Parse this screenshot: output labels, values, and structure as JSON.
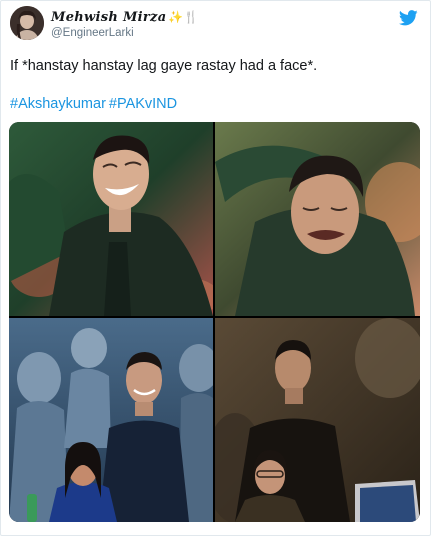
{
  "tweet": {
    "author": {
      "display_name": "Mehwish Mirza",
      "emoji": "✨🍴",
      "handle": "@EngineerLarki"
    },
    "text": "If *hanstay hanstay lag gaye rastay had a face*.",
    "hashtags": [
      "#Akshaykumar",
      "#PAKvIND"
    ],
    "media": [
      {
        "icon": "photo-laughing-green-jacket"
      },
      {
        "icon": "photo-crying-green-jacket"
      },
      {
        "icon": "photo-stadium-smiling"
      },
      {
        "icon": "photo-stadium-serious"
      }
    ]
  },
  "colors": {
    "text": "#14171a",
    "secondary": "#657786",
    "link": "#1b95e0",
    "twitter_blue": "#1da1f2",
    "border": "#e1e8ed"
  },
  "icons": {
    "platform": "twitter-bird-icon",
    "profile": "avatar"
  }
}
